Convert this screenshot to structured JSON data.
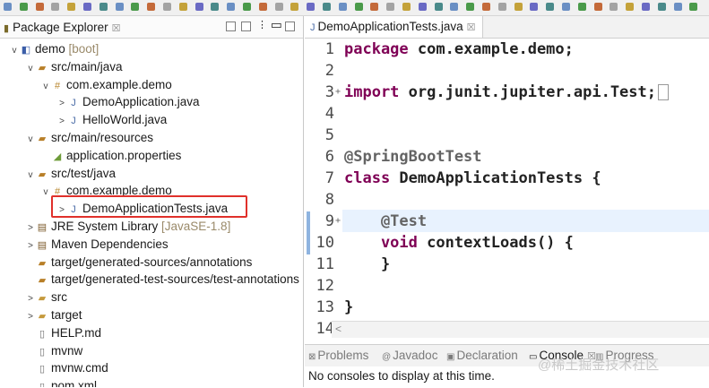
{
  "explorer": {
    "title": "Package Explorer",
    "close": "☒",
    "tree": [
      {
        "twisty": "v",
        "icon": "project-icon",
        "label": "demo",
        "muted": "[boot]"
      },
      {
        "twisty": "v",
        "icon": "source-folder-icon",
        "label": "src/main/java"
      },
      {
        "twisty": "v",
        "icon": "package-icon",
        "label": "com.example.demo"
      },
      {
        "twisty": ">",
        "icon": "java-file-icon",
        "label": "DemoApplication.java"
      },
      {
        "twisty": ">",
        "icon": "java-file-icon",
        "label": "HelloWorld.java"
      },
      {
        "twisty": "v",
        "icon": "source-folder-icon",
        "label": "src/main/resources"
      },
      {
        "twisty": "",
        "icon": "properties-file-icon",
        "label": "application.properties"
      },
      {
        "twisty": "v",
        "icon": "source-folder-icon",
        "label": "src/test/java"
      },
      {
        "twisty": "v",
        "icon": "package-icon",
        "label": "com.example.demo"
      },
      {
        "twisty": ">",
        "icon": "java-file-icon",
        "label": "DemoApplicationTests.java"
      },
      {
        "twisty": ">",
        "icon": "library-icon",
        "label": "JRE System Library",
        "muted": "[JavaSE-1.8]"
      },
      {
        "twisty": ">",
        "icon": "library-icon",
        "label": "Maven Dependencies"
      },
      {
        "twisty": "",
        "icon": "source-folder-icon",
        "label": "target/generated-sources/annotations"
      },
      {
        "twisty": "",
        "icon": "source-folder-icon",
        "label": "target/generated-test-sources/test-annotations"
      },
      {
        "twisty": ">",
        "icon": "folder-icon",
        "label": "src"
      },
      {
        "twisty": ">",
        "icon": "folder-icon",
        "label": "target"
      },
      {
        "twisty": "",
        "icon": "file-icon",
        "label": "HELP.md"
      },
      {
        "twisty": "",
        "icon": "file-icon",
        "label": "mvnw"
      },
      {
        "twisty": "",
        "icon": "file-icon",
        "label": "mvnw.cmd"
      },
      {
        "twisty": "",
        "icon": "file-icon",
        "label": "pom.xml"
      }
    ]
  },
  "editor": {
    "tab_label": "DemoApplicationTests.java",
    "close": "☒",
    "lines": [
      {
        "num": "1",
        "kw": "package",
        "rest": " com.example.demo;"
      },
      {
        "num": "2",
        "kw": "",
        "rest": ""
      },
      {
        "num": "3",
        "kw": "import",
        "rest": " org.junit.jupiter.api.Test;",
        "fold": true
      },
      {
        "num": "4",
        "kw": "",
        "rest": ""
      },
      {
        "num": "5",
        "kw": "",
        "rest": ""
      },
      {
        "num": "6",
        "kw": "",
        "rest": "@SpringBootTest",
        "ann": true
      },
      {
        "num": "7",
        "kw": "class",
        "rest": " DemoApplicationTests {"
      },
      {
        "num": "8",
        "kw": "",
        "rest": ""
      },
      {
        "num": "9",
        "kw": "",
        "rest": "    @Test",
        "ann": true,
        "fold": true
      },
      {
        "num": "10",
        "kw": "    void",
        "rest": " contextLoads() {"
      },
      {
        "num": "11",
        "kw": "",
        "rest": "    }"
      },
      {
        "num": "12",
        "kw": "",
        "rest": ""
      },
      {
        "num": "13",
        "kw": "",
        "rest": "}"
      },
      {
        "num": "14",
        "kw": "",
        "rest": ""
      }
    ]
  },
  "console": {
    "tabs": [
      {
        "label": "Problems",
        "icon": "problems-icon"
      },
      {
        "label": "Javadoc",
        "icon": "javadoc-icon"
      },
      {
        "label": "Declaration",
        "icon": "declaration-icon"
      },
      {
        "label": "Console",
        "icon": "console-icon",
        "active": true
      },
      {
        "label": "Progress",
        "icon": "progress-icon"
      }
    ],
    "message": "No consoles to display at this time."
  },
  "watermark": "@稀土掘金技术社区",
  "colors": {
    "highlight_box": "#e0302b",
    "keyword": "#7f0055",
    "current_line": "#e8f2fe"
  }
}
